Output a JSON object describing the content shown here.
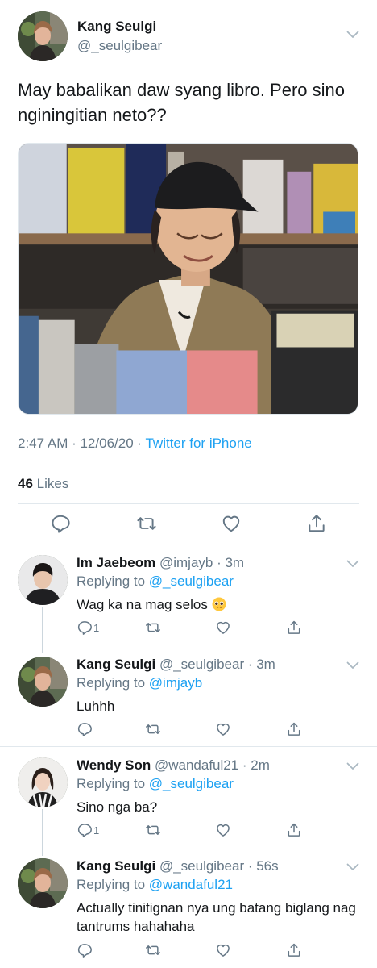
{
  "tweet": {
    "author_name": "Kang Seulgi",
    "author_handle": "@_seulgibear",
    "text": "May babalikan daw syang libro. Pero sino nginingitian neto??",
    "time": "2:47 AM · 12/06/20 · ",
    "source": "Twitter for iPhone",
    "likes_count": "46",
    "likes_label": " Likes"
  },
  "replies": [
    {
      "name": "Im Jaebeom",
      "handle": " @imjayb",
      "time": " · 3m",
      "replying_label": "Replying to ",
      "replying_to": "@_seulgibear",
      "text": "Wag ka na mag selos ",
      "reply_count": "1"
    },
    {
      "name": "Kang Seulgi",
      "handle": " @_seulgibear",
      "time": " · 3m",
      "replying_label": "Replying to ",
      "replying_to": "@imjayb",
      "text": "Luhhh",
      "reply_count": ""
    },
    {
      "name": "Wendy Son",
      "handle": " @wandaful21",
      "time": " · 2m",
      "replying_label": "Replying to ",
      "replying_to": "@_seulgibear",
      "text": "Sino nga ba?",
      "reply_count": "1"
    },
    {
      "name": "Kang Seulgi",
      "handle": " @_seulgibear",
      "time": " · 56s",
      "replying_label": "Replying to ",
      "replying_to": "@wandaful21",
      "text": "Actually tinitignan nya ung batang biglang nag tantrums hahahaha",
      "reply_count": ""
    }
  ],
  "icons": {
    "reply": "reply-icon",
    "retweet": "retweet-icon",
    "like": "heart-icon",
    "share": "share-icon",
    "more": "chevron-down-icon",
    "emoji": "pleading-face-emoji"
  },
  "colors": {
    "link": "#1da1f2",
    "secondary": "#657786",
    "text": "#14171a",
    "divider": "#e1e8ed"
  }
}
